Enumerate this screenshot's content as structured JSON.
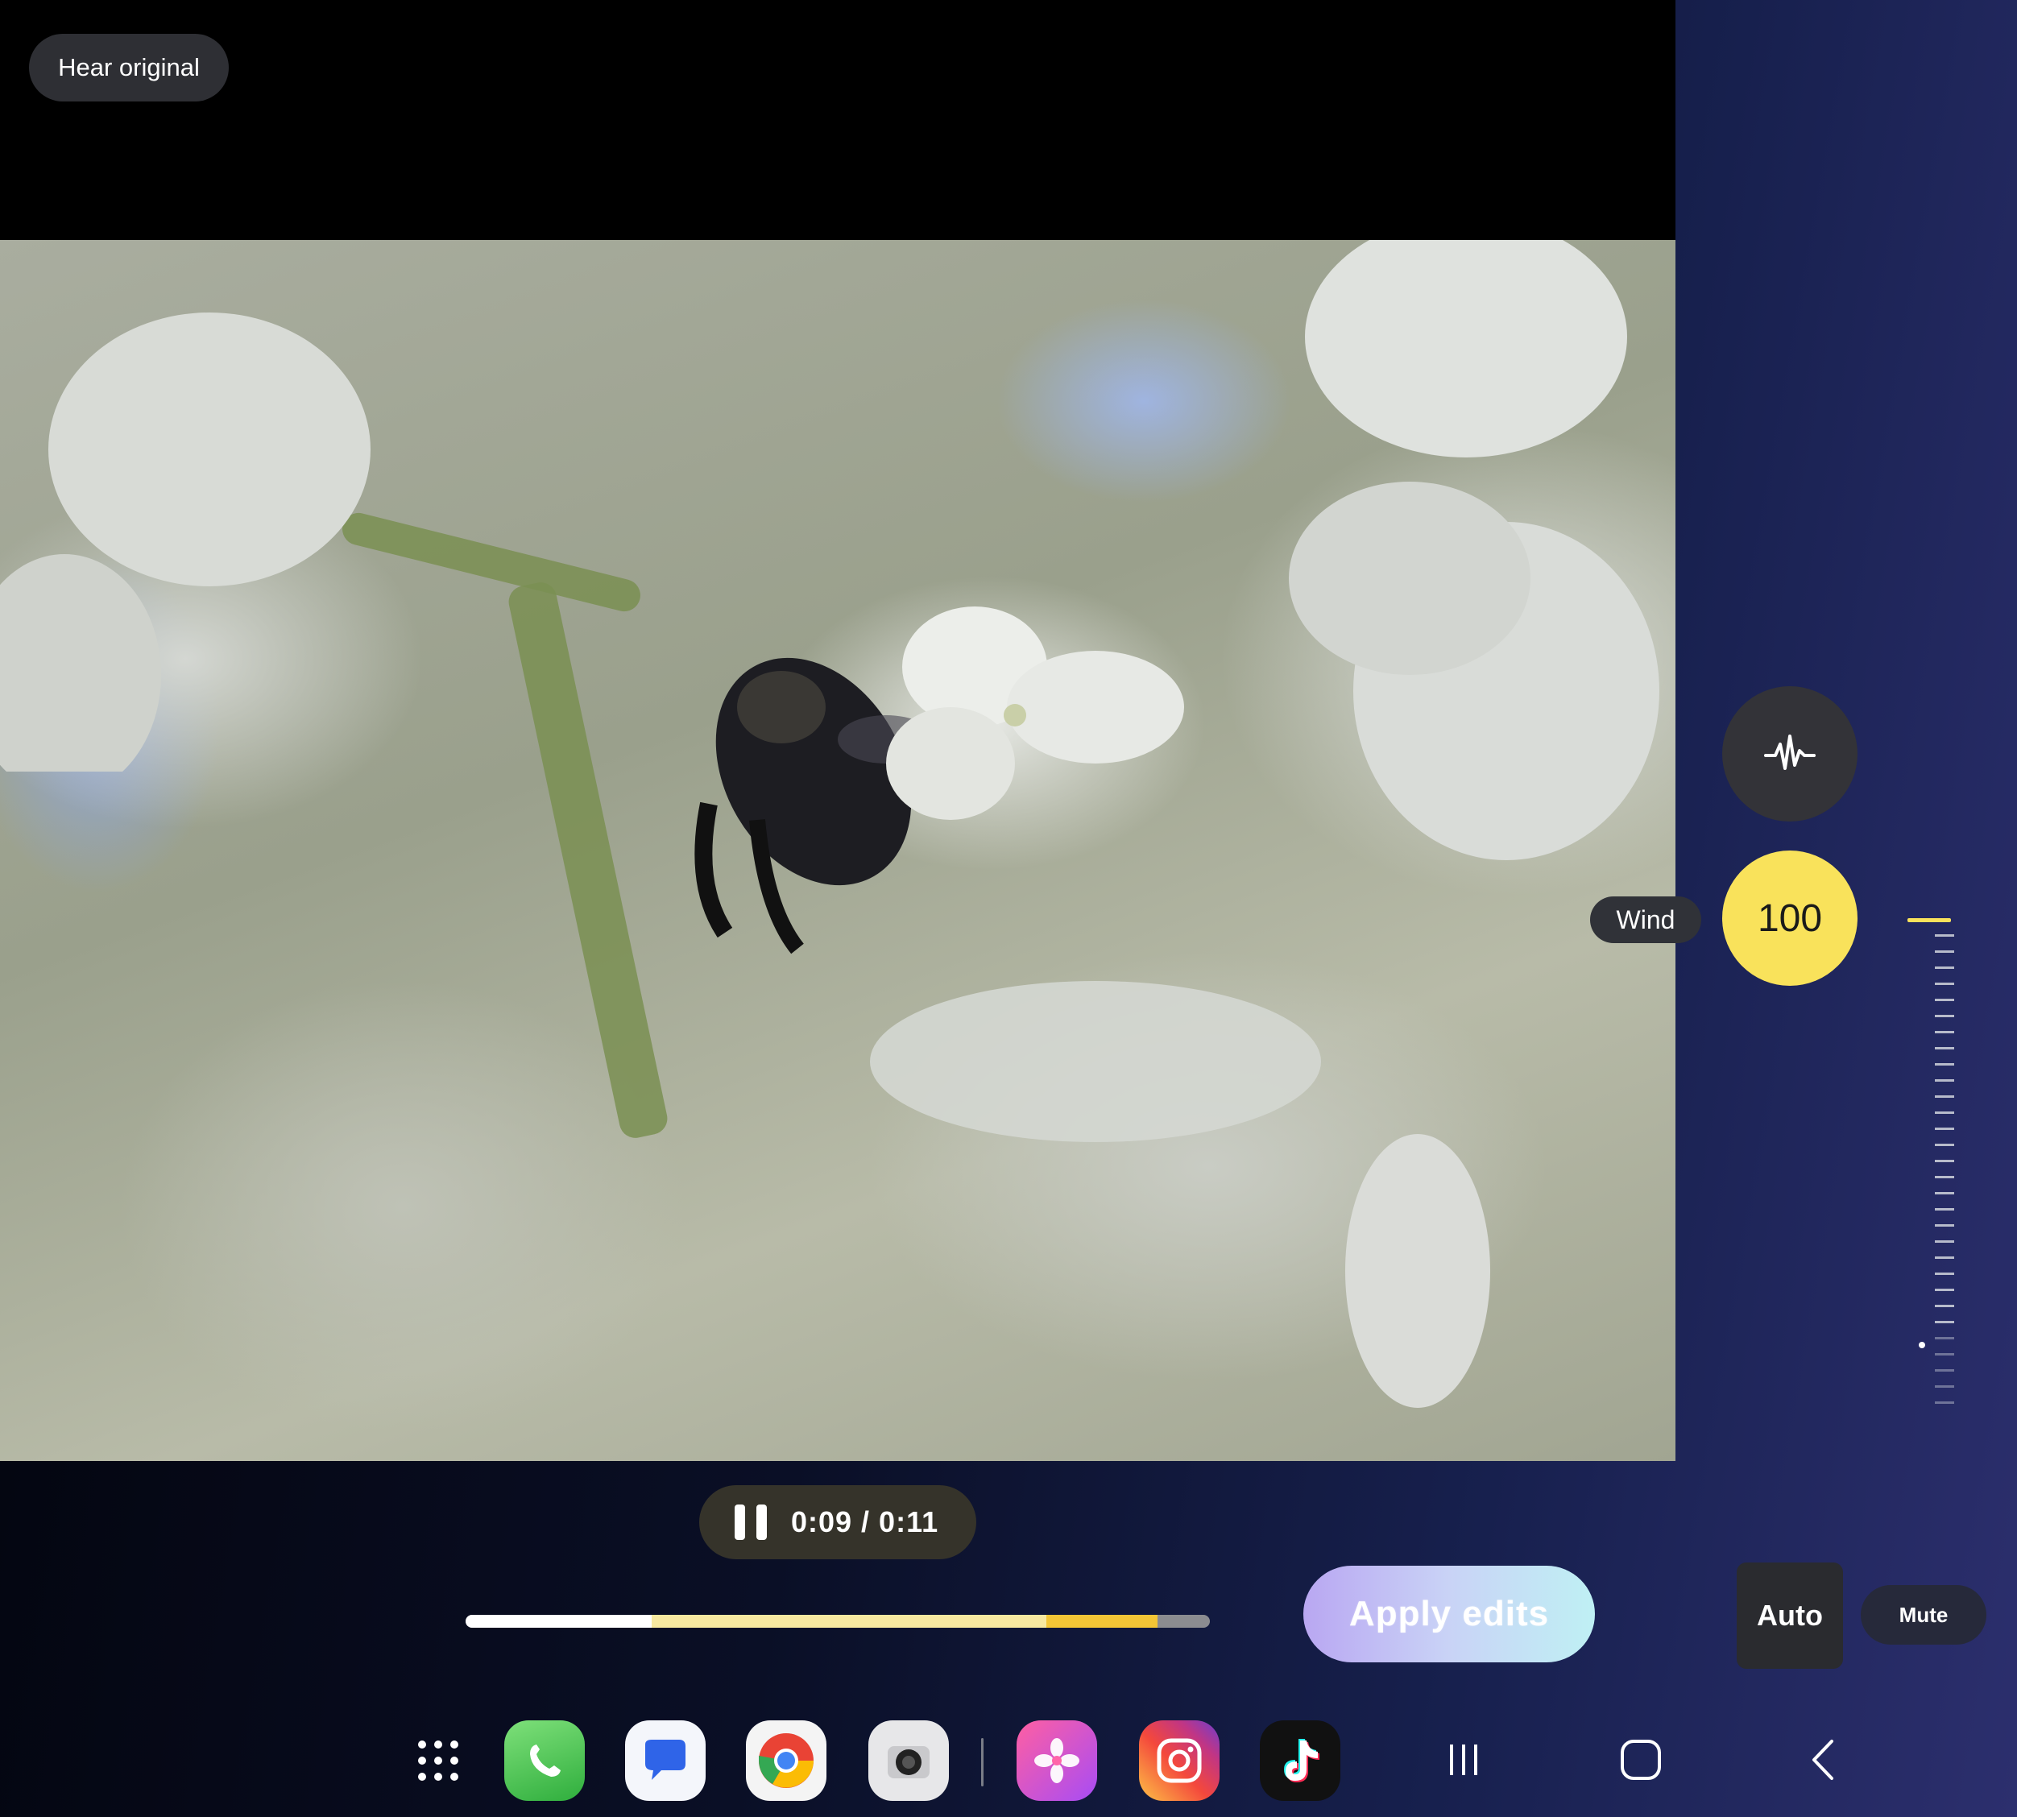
{
  "header": {
    "hear_original_label": "Hear original"
  },
  "player": {
    "time_label": "0:09 / 0:11",
    "progress_fraction": 0.27,
    "timeline_segments": [
      {
        "start": 0.25,
        "end": 0.78,
        "color": "#f7e8a0"
      },
      {
        "start": 0.78,
        "end": 0.93,
        "color": "#f3c536"
      }
    ]
  },
  "actions": {
    "apply_label": "Apply edits"
  },
  "audio_panel": {
    "wind_label": "Wind",
    "level_value": "100",
    "auto_label": "Auto",
    "mute_label": "Mute",
    "accent_color": "#f9e25b"
  },
  "taskbar": {
    "apps": [
      {
        "name": "app-drawer-icon"
      },
      {
        "name": "phone-app-icon"
      },
      {
        "name": "messages-app-icon"
      },
      {
        "name": "chrome-app-icon"
      },
      {
        "name": "camera-app-icon"
      },
      {
        "name": "gallery-app-icon"
      },
      {
        "name": "instagram-app-icon"
      },
      {
        "name": "tiktok-app-icon"
      }
    ],
    "nav": [
      {
        "name": "recents-icon"
      },
      {
        "name": "home-icon"
      },
      {
        "name": "back-icon"
      }
    ]
  }
}
